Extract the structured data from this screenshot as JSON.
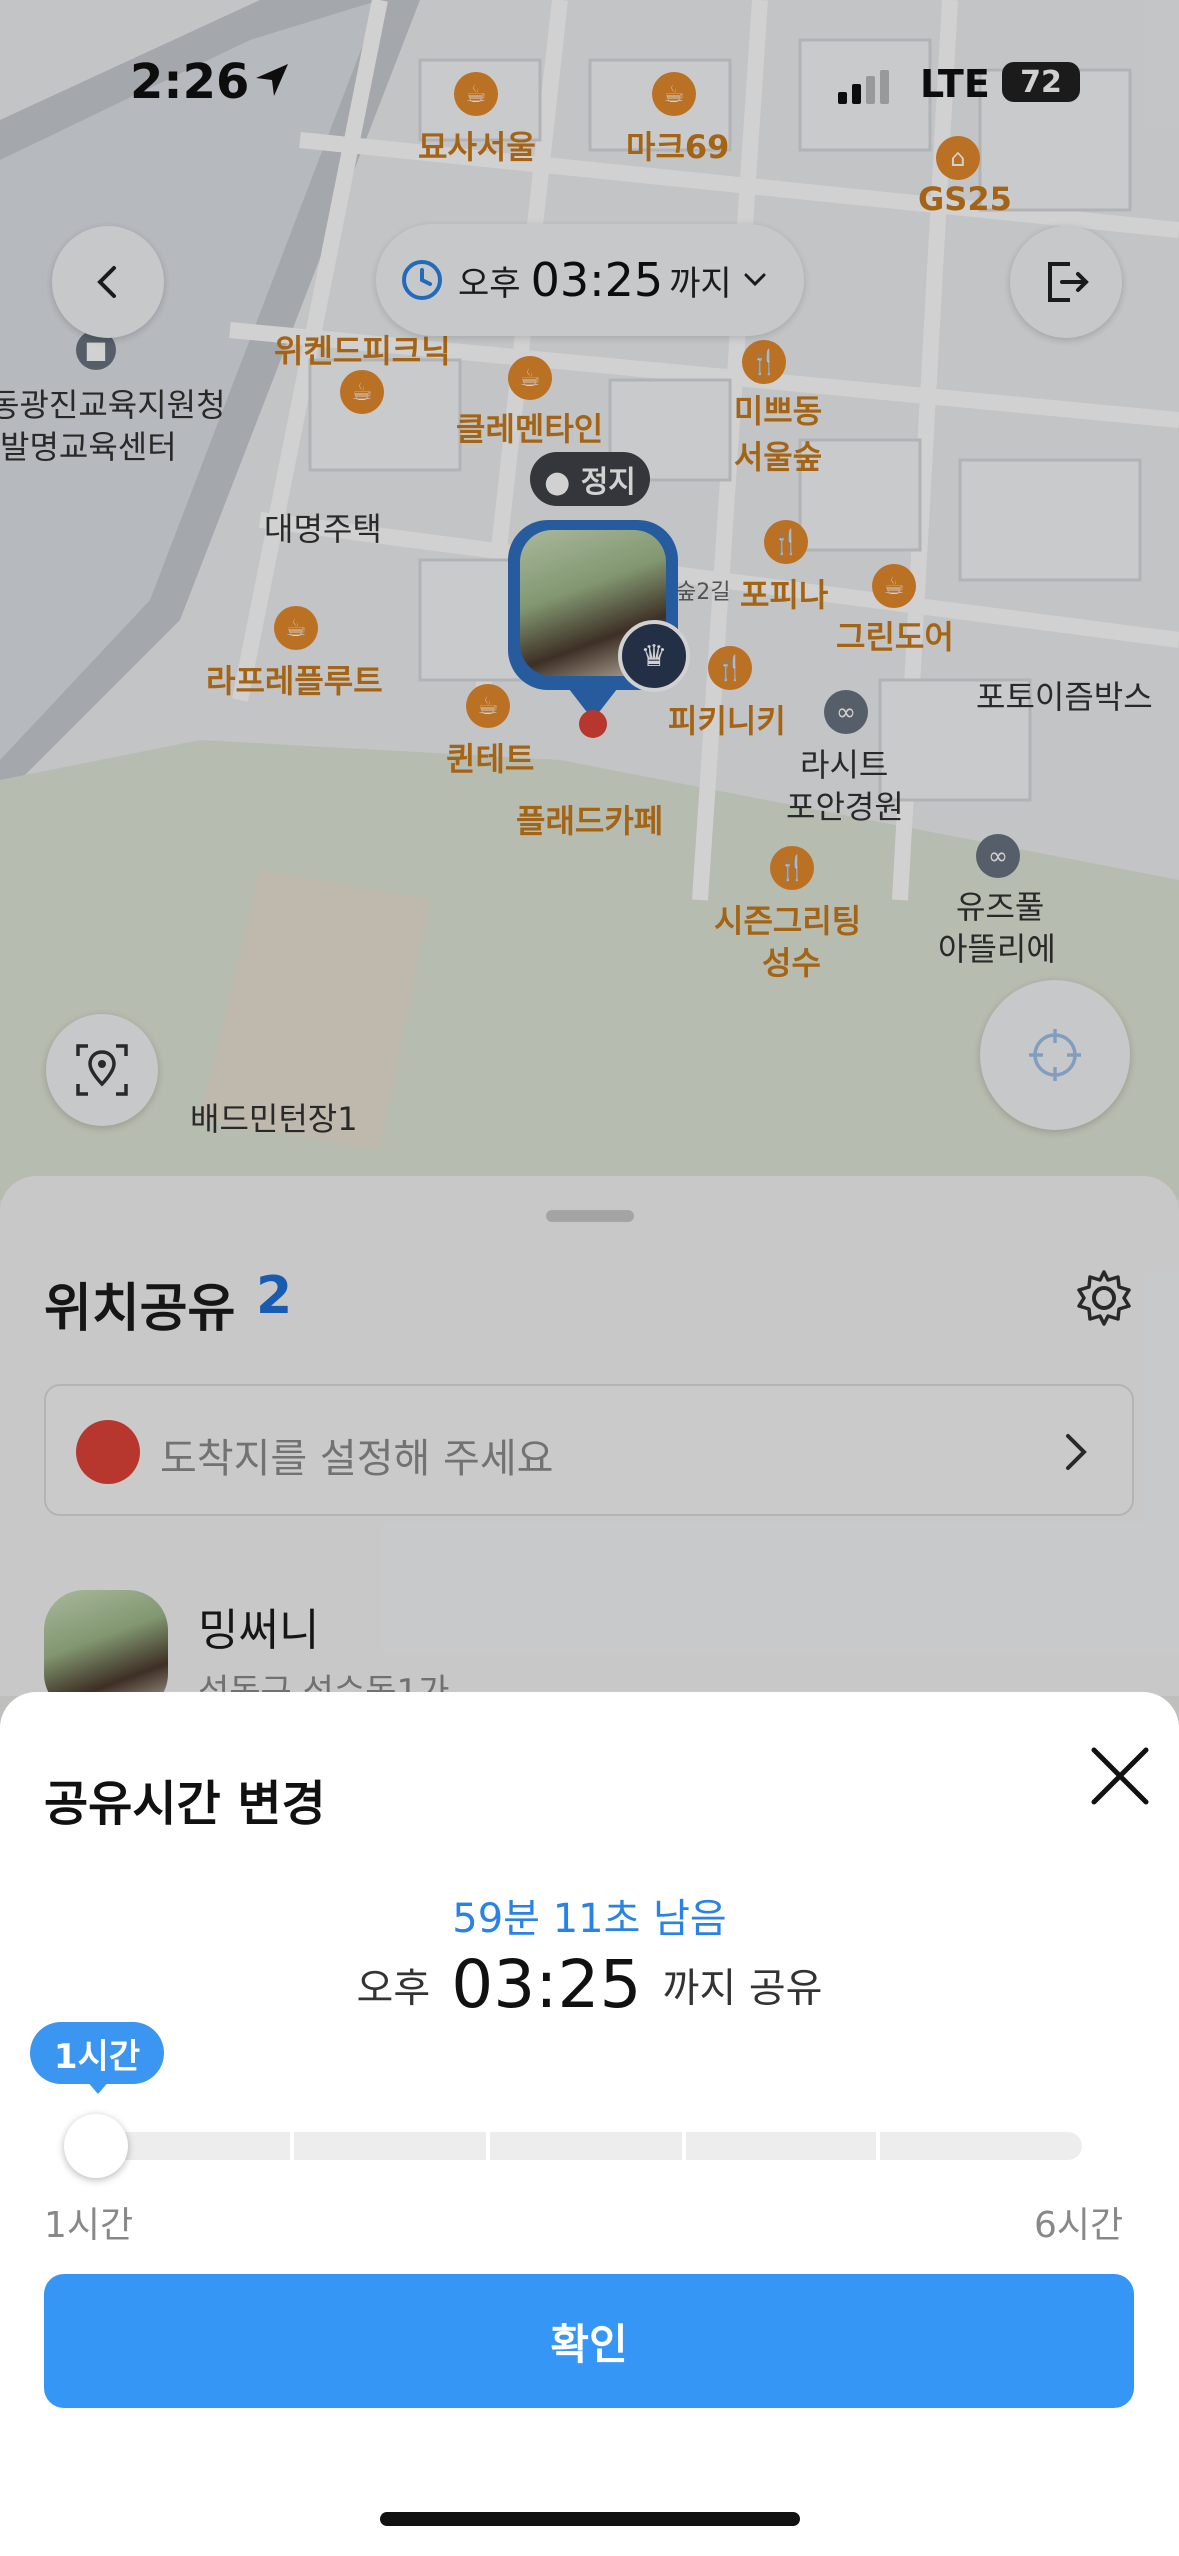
{
  "status_bar": {
    "time": "2:26",
    "network": "LTE",
    "battery": "72"
  },
  "map": {
    "time_pill": {
      "ampm": "오후",
      "time": "03:25",
      "until": "까지"
    },
    "stop_badge": "● 정지",
    "places": [
      "묘사서울",
      "마크69",
      "GS25",
      "위켄드피크닉",
      "클레멘타인",
      "미쁘동 서울숲",
      "동광진교육지원청",
      "발명교육센터",
      "대명주택",
      "포피나",
      "그린도어",
      "라프레플루트",
      "피키니키",
      "포토이즘박스",
      "퀸테트",
      "라시트",
      "포안경원",
      "플래드카페",
      "시즌그리팅",
      "성수",
      "유즈풀",
      "아뜰리에",
      "배드민턴장1",
      "숲2길"
    ]
  },
  "sheet": {
    "title": "위치공유",
    "count": "2",
    "destination_placeholder": "도착지를 설정해 주세요",
    "friend": {
      "name": "밍써니",
      "address": "성동구 성수동1가"
    }
  },
  "modal": {
    "title": "공유시간 변경",
    "remaining": "59분 11초 남음",
    "until_prefix": "오후",
    "until_time": "03:25",
    "until_suffix": "까지 공유",
    "slider": {
      "tooltip": "1시간",
      "min_label": "1시간",
      "max_label": "6시간",
      "value_hours": 1,
      "min_hours": 1,
      "max_hours": 6
    },
    "confirm_label": "확인"
  },
  "colors": {
    "accent": "#3596f5",
    "poi": "#e48a2b",
    "pin": "#2f6fc0"
  }
}
